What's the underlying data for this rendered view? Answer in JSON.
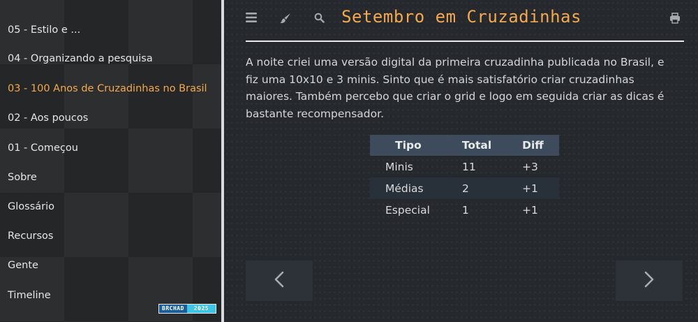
{
  "sidebar": {
    "items": [
      {
        "label": "05 - Estilo e ...",
        "active": false
      },
      {
        "label": "04 - Organizando a pesquisa",
        "active": false
      },
      {
        "label": "03 - 100 Anos de Cruzadinhas no Brasil",
        "active": true
      },
      {
        "label": "02 - Aos poucos",
        "active": false
      },
      {
        "label": "01 - Começou",
        "active": false
      },
      {
        "label": "Sobre",
        "active": false
      },
      {
        "label": "Glossário",
        "active": false
      },
      {
        "label": "Recursos",
        "active": false
      },
      {
        "label": "Gente",
        "active": false
      },
      {
        "label": "Timeline",
        "active": false
      }
    ],
    "badge": {
      "left": "BRCHAD",
      "right": "2025"
    }
  },
  "toolbar": {
    "icons": [
      "menu-icon",
      "brush-icon",
      "search-icon",
      "print-icon"
    ]
  },
  "page": {
    "title": "Setembro em Cruzadinhas",
    "paragraph": "A noite criei uma versão digital da primeira cruzadinha publicada no Brasil, e fiz uma 10x10 e 3 minis. Sinto que é mais satisfatório criar cruzadinhas maiores. Também percebo que criar o grid e logo em seguida criar as dicas é bastante recompensador."
  },
  "table": {
    "headers": [
      "Tipo",
      "Total",
      "Diff"
    ],
    "rows": [
      [
        "Minis",
        "11",
        "+3"
      ],
      [
        "Médias",
        "2",
        "+1"
      ],
      [
        "Especial",
        "1",
        "+1"
      ]
    ]
  },
  "colors": {
    "accent": "#f5a94a",
    "table_header": "#3d4b5c",
    "badge_left": "#1a5f9a",
    "badge_right": "#3fc4e6"
  }
}
